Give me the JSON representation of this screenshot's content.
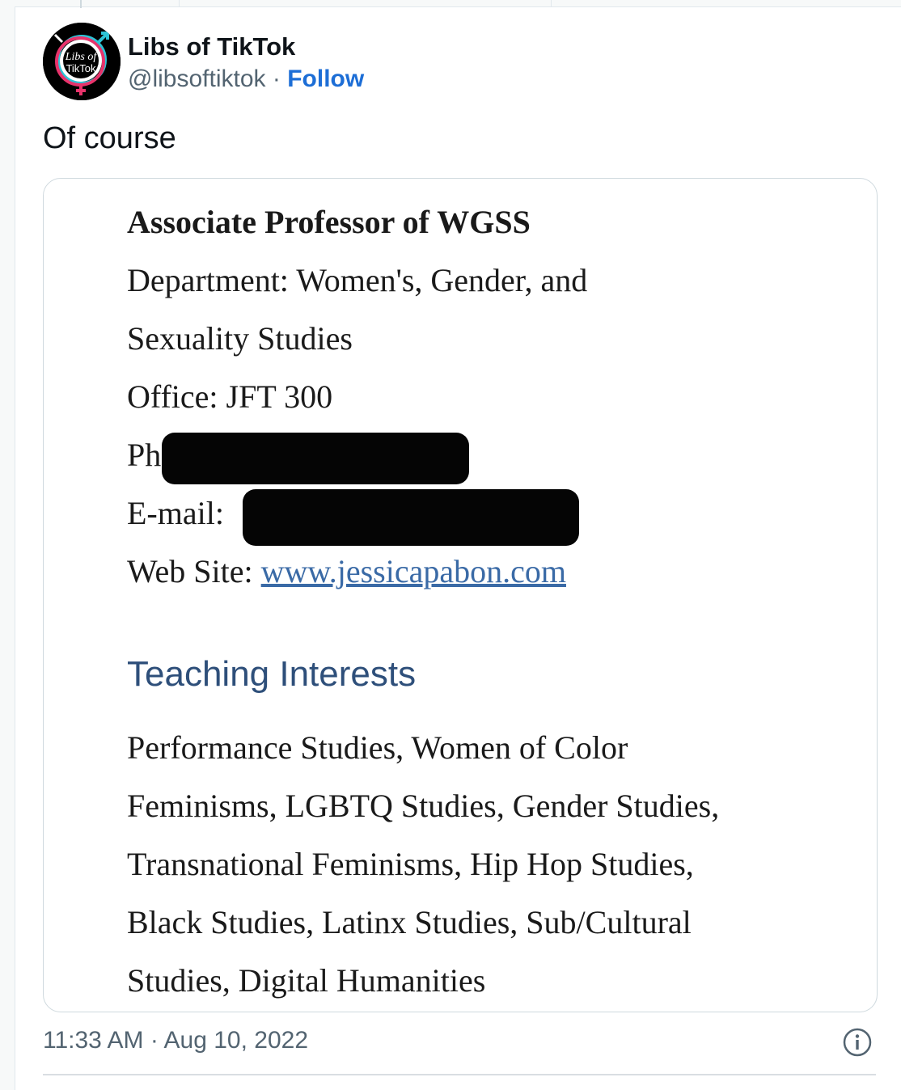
{
  "author": {
    "display_name": "Libs of TikTok",
    "handle": "@libsoftiktok",
    "separator": "·",
    "follow_label": "Follow",
    "avatar_text_line1": "Libs of",
    "avatar_text_line2": "TikTok"
  },
  "tweet": {
    "text": "Of course",
    "timestamp": "11:33 AM · Aug 10, 2022"
  },
  "media": {
    "heading": "Associate Professor of WGSS",
    "department_line1": "Department: Women's, Gender, and",
    "department_line2": "Sexuality Studies",
    "office": "Office: JFT 300",
    "phone_label": "Phone: (",
    "email_label": "E-mail:",
    "website_label": "Web Site: ",
    "website_url": "www.jessicapabon.com",
    "section_title": "Teaching Interests",
    "interests_lines": [
      "Performance Studies, Women of Color",
      "Feminisms, LGBTQ Studies, Gender Studies,",
      "Transnational Feminisms, Hip Hop Studies,",
      "Black Studies, Latinx Studies, Sub/Cultural",
      "Studies, Digital Humanities"
    ]
  },
  "colors": {
    "follow": "#1d6ed6",
    "link": "#3a6aa6",
    "section_title": "#2e4f7a",
    "secondary_text": "#536471"
  },
  "icons": [
    "info-icon"
  ]
}
